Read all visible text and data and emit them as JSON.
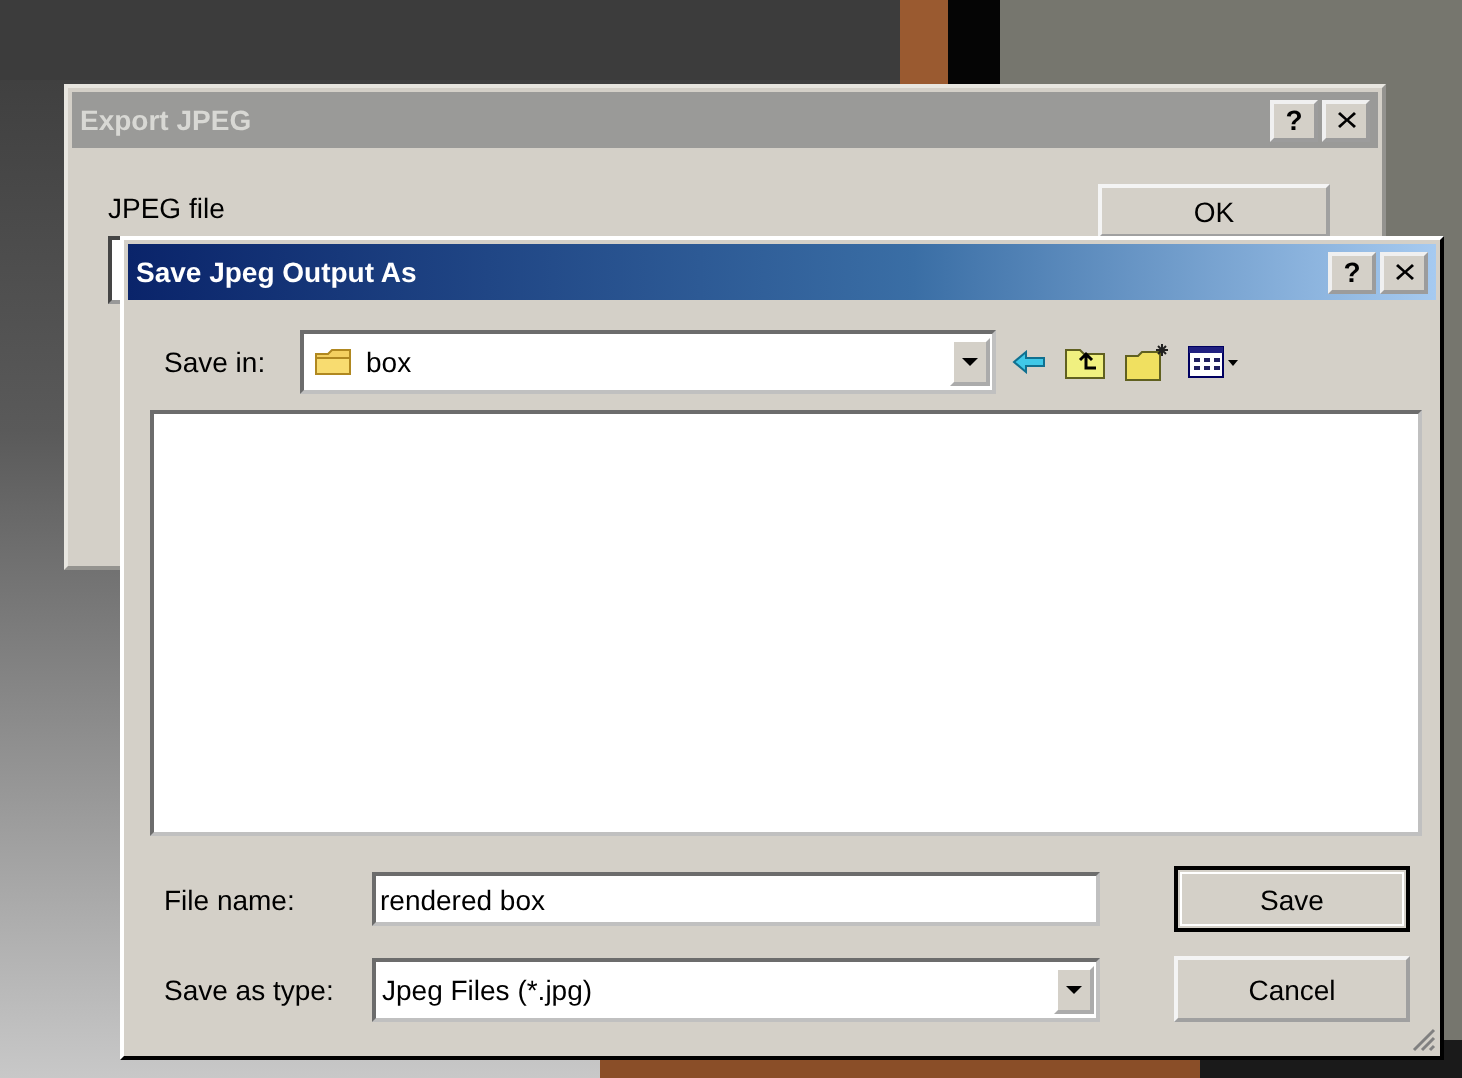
{
  "export_dialog": {
    "title": "Export JPEG",
    "active": false,
    "help_button": "?",
    "file_label": "JPEG file",
    "ok_button": "OK"
  },
  "save_dialog": {
    "title": "Save Jpeg Output As",
    "active": true,
    "help_button": "?",
    "save_in": {
      "label": "Save in:",
      "value": "box"
    },
    "file_name": {
      "label": "File name:",
      "value": "rendered box"
    },
    "save_as_type": {
      "label": "Save as type:",
      "value": "Jpeg Files (*.jpg)"
    },
    "buttons": [
      "Save",
      "Cancel"
    ]
  }
}
